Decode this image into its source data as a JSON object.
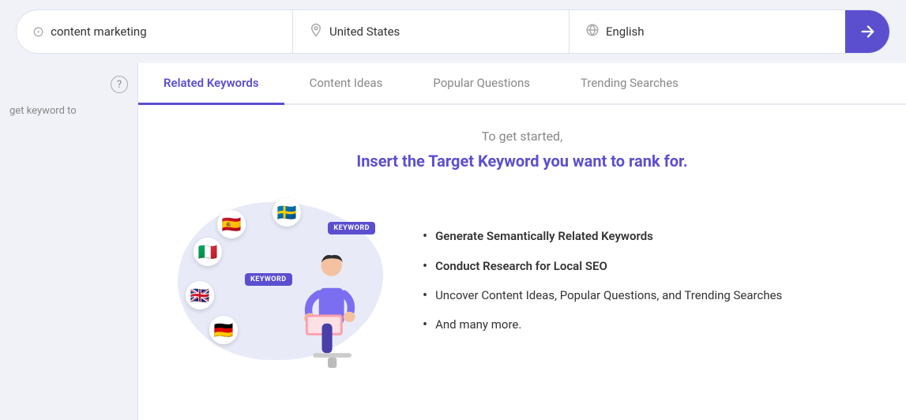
{
  "searchBar": {
    "query": {
      "placeholder": "content marketing",
      "icon": "🎯"
    },
    "location": {
      "value": "United States",
      "icon": "📍"
    },
    "language": {
      "value": "English",
      "icon": "🌐"
    },
    "submitIcon": "→"
  },
  "tabs": [
    {
      "id": "related-keywords",
      "label": "Related Keywords",
      "active": true
    },
    {
      "id": "content-ideas",
      "label": "Content Ideas",
      "active": false
    },
    {
      "id": "popular-questions",
      "label": "Popular Questions",
      "active": false
    },
    {
      "id": "trending-searches",
      "label": "Trending Searches",
      "active": false
    }
  ],
  "sidebar": {
    "helpIcon": "?",
    "promptText": "get keyword to"
  },
  "contentArea": {
    "subtitle": "To get started,",
    "title": "Insert the Target Keyword you want to rank for.",
    "features": [
      {
        "text": "Generate Semantically Related Keywords",
        "bold": true
      },
      {
        "text": "Conduct Research for Local SEO",
        "bold": true
      },
      {
        "text": "Uncover Content Ideas, Popular Questions, and Trending Searches",
        "bold": false
      },
      {
        "text": "And many more.",
        "bold": false
      }
    ]
  },
  "flags": [
    "🇪🇸",
    "🇸🇪",
    "🇮🇹",
    "🇬🇧",
    "🇩🇪"
  ],
  "keywordBadges": [
    "KEYWORD",
    "KEYWORD"
  ]
}
